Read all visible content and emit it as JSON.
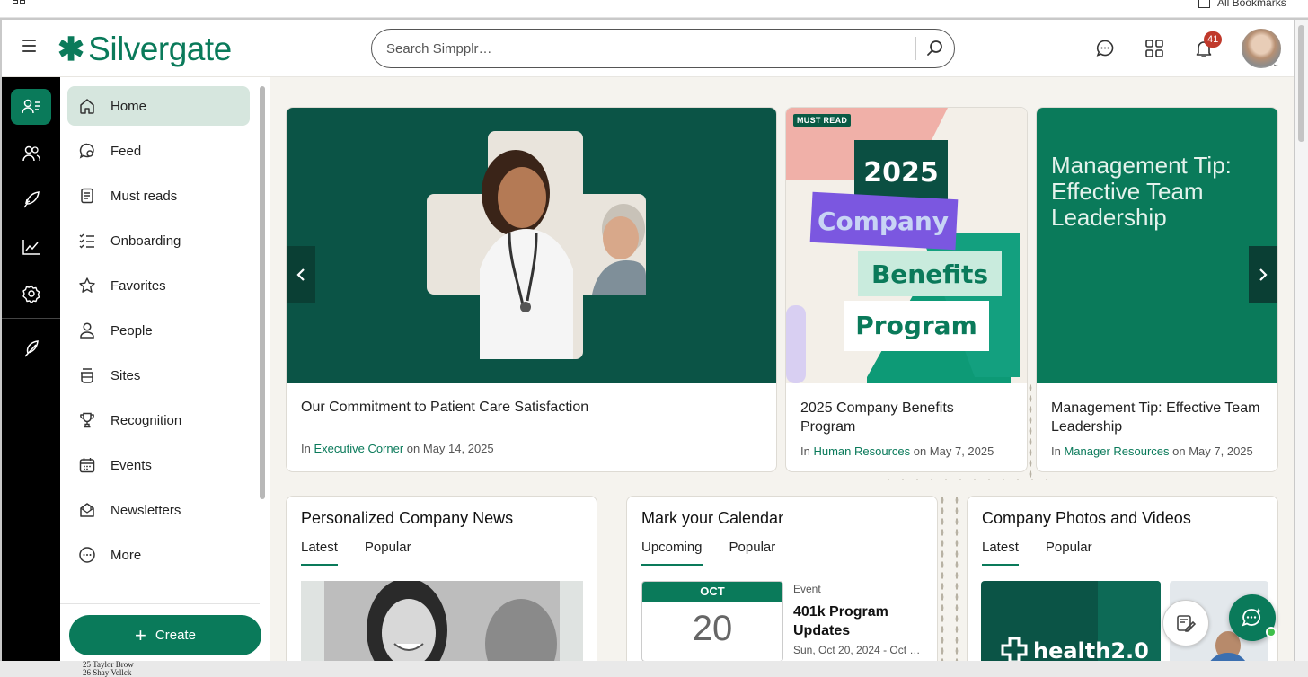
{
  "browser": {
    "bookmarks_label": "All Bookmarks"
  },
  "header": {
    "logo_mark": "✱",
    "logo_text": "Silvergate",
    "search_placeholder": "Search Simpplr…",
    "notification_count": "41",
    "icons": [
      "hamburger-icon",
      "chat-icon",
      "apps-grid-icon",
      "bell-icon"
    ]
  },
  "sidebar": {
    "items": [
      {
        "label": "Home",
        "icon": "home-icon",
        "active": true
      },
      {
        "label": "Feed",
        "icon": "feed-icon"
      },
      {
        "label": "Must reads",
        "icon": "must-reads-icon"
      },
      {
        "label": "Onboarding",
        "icon": "onboarding-icon"
      },
      {
        "label": "Favorites",
        "icon": "star-icon"
      },
      {
        "label": "People",
        "icon": "person-icon"
      },
      {
        "label": "Sites",
        "icon": "sites-icon"
      },
      {
        "label": "Recognition",
        "icon": "trophy-icon"
      },
      {
        "label": "Events",
        "icon": "calendar-icon"
      },
      {
        "label": "Newsletters",
        "icon": "newsletter-icon"
      },
      {
        "label": "More",
        "icon": "more-icon"
      }
    ],
    "create_label": "Create"
  },
  "carousel": {
    "cards": [
      {
        "title": "Our Commitment to Patient Care Satisfaction",
        "meta_prefix": "In ",
        "site": "Executive Corner",
        "meta_date": " on May 14, 2025"
      },
      {
        "title": "2025 Company Benefits Program",
        "badge": "MUST READ",
        "image_words": [
          "2025",
          "Company",
          "Benefits",
          "Program"
        ],
        "meta_prefix": "In ",
        "site": "Human Resources",
        "meta_date": " on May 7, 2025"
      },
      {
        "title": "Management Tip: Effective Team Leadership",
        "image_text": "Management Tip: Effective Team Leadership",
        "meta_prefix": "In ",
        "site": "Manager Resources",
        "meta_date": " on May 7, 2025"
      }
    ]
  },
  "widgets": {
    "news": {
      "title": "Personalized Company News",
      "tabs": [
        "Latest",
        "Popular"
      ]
    },
    "calendar": {
      "title": "Mark your Calendar",
      "tabs": [
        "Upcoming",
        "Popular"
      ],
      "event": {
        "month": "OCT",
        "day": "20",
        "type": "Event",
        "title": "401k Program Updates",
        "date": "Sun, Oct 20, 2024 - Oct …"
      }
    },
    "media": {
      "title": "Company Photos and Videos",
      "tabs": [
        "Latest",
        "Popular"
      ],
      "thumb_text": "health2.0"
    }
  },
  "desktop_bg": {
    "rows": [
      "25  Taylor Brow",
      "26  Shay Vellck"
    ]
  },
  "colors": {
    "brand": "#0a7a5a",
    "brand_dark": "#0b4f42",
    "hero_bg": "#0b5446",
    "badge": "#c0392b",
    "page_bg": "#f5f3ee"
  }
}
